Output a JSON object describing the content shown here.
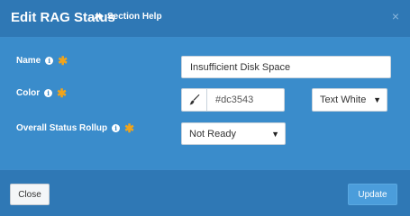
{
  "dialog": {
    "title": "Edit RAG Status",
    "section_help": "Section Help",
    "close_glyph": "×"
  },
  "form": {
    "name": {
      "label": "Name",
      "value": "Insufficient Disk Space"
    },
    "color": {
      "label": "Color",
      "hex_value": "#dc3543",
      "text_color_selected": "Text White"
    },
    "rollup": {
      "label": "Overall Status Rollup",
      "selected": "Not Ready"
    },
    "info_glyph": "i",
    "required_glyph": "✱"
  },
  "footer": {
    "close_label": "Close",
    "update_label": "Update"
  },
  "colors": {
    "header": "#2f78b5",
    "body": "#3a8ccb",
    "accent_required": "#f0a41c",
    "update_button": "#4b9ddb"
  }
}
